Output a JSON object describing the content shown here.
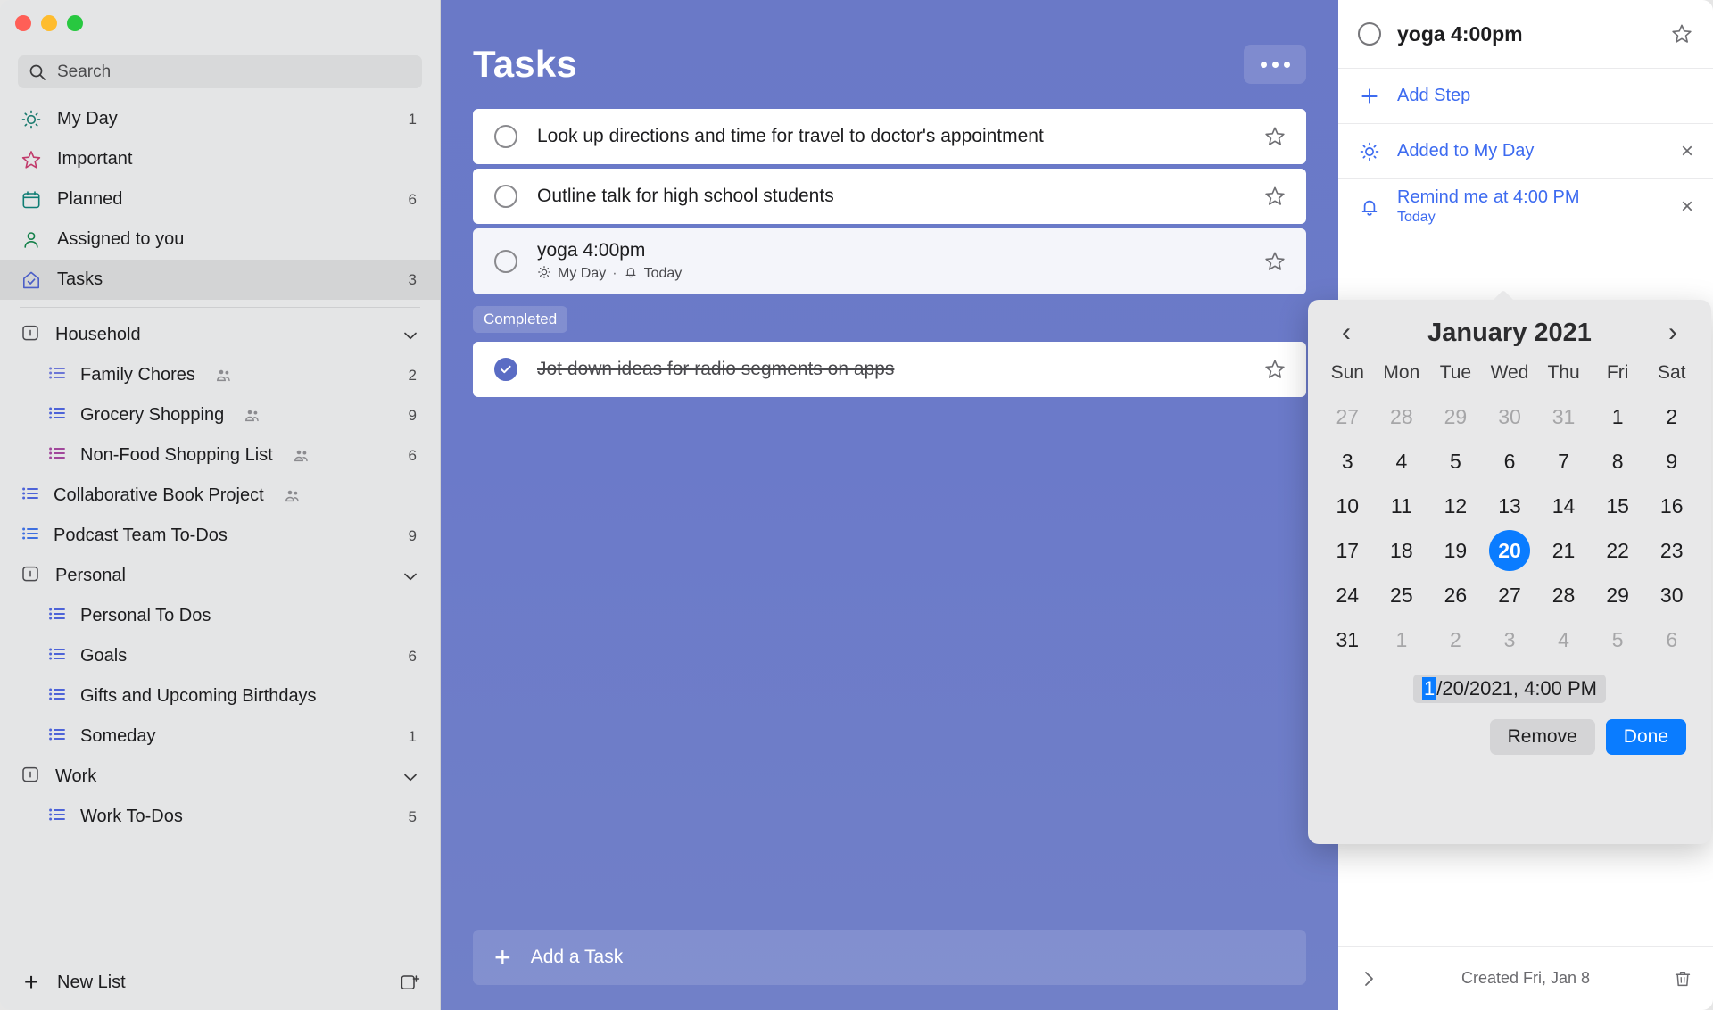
{
  "window": {
    "traffic_lights": [
      "close",
      "minimize",
      "zoom"
    ],
    "colors": {
      "accent_main": "#6b7ac9",
      "accent_blue": "#0a7cff",
      "link_blue": "#3d6bf0"
    }
  },
  "sidebar": {
    "search": {
      "placeholder": "Search",
      "value": "",
      "icon": "search-icon"
    },
    "smart_lists": [
      {
        "label": "My Day",
        "count": "1",
        "icon": "sun-icon"
      },
      {
        "label": "Important",
        "count": "",
        "icon": "star-icon"
      },
      {
        "label": "Planned",
        "count": "6",
        "icon": "calendar-icon"
      },
      {
        "label": "Assigned to you",
        "count": "",
        "icon": "person-icon"
      },
      {
        "label": "Tasks",
        "count": "3",
        "icon": "home-check-icon",
        "selected": true
      }
    ],
    "groups": [
      {
        "label": "Household",
        "icon": "group-icon",
        "chevron": "chevron-down-icon",
        "lists": [
          {
            "label": "Family Chores",
            "count": "2",
            "shared": true,
            "icon": "list-icon"
          },
          {
            "label": "Grocery Shopping",
            "count": "9",
            "shared": true,
            "icon": "list-icon"
          },
          {
            "label": "Non-Food Shopping List",
            "count": "6",
            "shared": true,
            "icon": "list-icon"
          }
        ]
      }
    ],
    "flat_lists": [
      {
        "label": "Collaborative Book Project",
        "count": "",
        "shared": true,
        "icon": "list-icon"
      },
      {
        "label": "Podcast Team To-Dos",
        "count": "9",
        "shared": false,
        "icon": "list-icon"
      }
    ],
    "group_personal": {
      "label": "Personal",
      "icon": "group-icon",
      "chevron": "chevron-down-icon",
      "lists": [
        {
          "label": "Personal To Dos",
          "count": "",
          "shared": false,
          "icon": "list-icon"
        },
        {
          "label": "Goals",
          "count": "6",
          "shared": false,
          "icon": "list-icon"
        },
        {
          "label": "Gifts and Upcoming Birthdays",
          "count": "",
          "shared": false,
          "icon": "list-icon"
        },
        {
          "label": "Someday",
          "count": "1",
          "shared": false,
          "icon": "list-icon"
        }
      ]
    },
    "group_work": {
      "label": "Work",
      "icon": "group-icon",
      "chevron": "chevron-down-icon",
      "lists": [
        {
          "label": "Work To-Dos",
          "count": "5",
          "shared": false,
          "icon": "list-icon"
        }
      ]
    },
    "new_list": {
      "label": "New List",
      "icon": "plus-icon",
      "right_icon": "new-group-icon"
    }
  },
  "main": {
    "title": "Tasks",
    "more_button": "more-options-icon",
    "tasks": [
      {
        "text": "Look up directions and time for travel to doctor's appointment",
        "done": false,
        "starred": false,
        "meta": ""
      },
      {
        "text": "Outline talk for high school students",
        "done": false,
        "starred": false,
        "meta": ""
      },
      {
        "text": "yoga 4:00pm",
        "done": false,
        "starred": false,
        "selected": true,
        "meta_myday": "My Day",
        "meta_sep": "·",
        "meta_due": "Today"
      }
    ],
    "completed_label": "Completed",
    "completed_tasks": [
      {
        "text": "Jot down ideas for radio segments on apps",
        "done": true,
        "starred": false
      }
    ],
    "add_task": {
      "label": "Add a Task",
      "plus": "+"
    }
  },
  "detail": {
    "task_title": "yoga 4:00pm",
    "checkbox": "checkbox-unchecked-icon",
    "star": "star-icon",
    "add_step": {
      "label": "Add Step",
      "icon": "plus-icon"
    },
    "my_day": {
      "label": "Added to My Day",
      "icon": "sun-icon",
      "remove": "×"
    },
    "reminder": {
      "label": "Remind me at 4:00 PM",
      "sub": "Today",
      "icon": "bell-icon",
      "remove": "×"
    },
    "footer": {
      "chevron": "chevron-right-icon",
      "created": "Created Fri, Jan 8",
      "delete": "trash-icon"
    }
  },
  "calendar": {
    "prev": "‹",
    "next": "›",
    "month_title": "January 2021",
    "day_headers": [
      "Sun",
      "Mon",
      "Tue",
      "Wed",
      "Thu",
      "Fri",
      "Sat"
    ],
    "weeks": [
      [
        {
          "d": "27",
          "muted": true
        },
        {
          "d": "28",
          "muted": true
        },
        {
          "d": "29",
          "muted": true
        },
        {
          "d": "30",
          "muted": true
        },
        {
          "d": "31",
          "muted": true
        },
        {
          "d": "1"
        },
        {
          "d": "2"
        }
      ],
      [
        {
          "d": "3"
        },
        {
          "d": "4"
        },
        {
          "d": "5"
        },
        {
          "d": "6"
        },
        {
          "d": "7"
        },
        {
          "d": "8"
        },
        {
          "d": "9"
        }
      ],
      [
        {
          "d": "10"
        },
        {
          "d": "11"
        },
        {
          "d": "12"
        },
        {
          "d": "13"
        },
        {
          "d": "14"
        },
        {
          "d": "15"
        },
        {
          "d": "16"
        }
      ],
      [
        {
          "d": "17"
        },
        {
          "d": "18"
        },
        {
          "d": "19"
        },
        {
          "d": "20",
          "selected": true
        },
        {
          "d": "21"
        },
        {
          "d": "22"
        },
        {
          "d": "23"
        }
      ],
      [
        {
          "d": "24"
        },
        {
          "d": "25"
        },
        {
          "d": "26"
        },
        {
          "d": "27"
        },
        {
          "d": "28"
        },
        {
          "d": "29"
        },
        {
          "d": "30"
        }
      ],
      [
        {
          "d": "31"
        },
        {
          "d": "1",
          "muted": true
        },
        {
          "d": "2",
          "muted": true
        },
        {
          "d": "3",
          "muted": true
        },
        {
          "d": "4",
          "muted": true
        },
        {
          "d": "5",
          "muted": true
        },
        {
          "d": "6",
          "muted": true
        }
      ]
    ],
    "datetime_field": {
      "highlighted": "1",
      "rest": "/20/2021,  4:00 PM"
    },
    "remove_label": "Remove",
    "done_label": "Done"
  }
}
